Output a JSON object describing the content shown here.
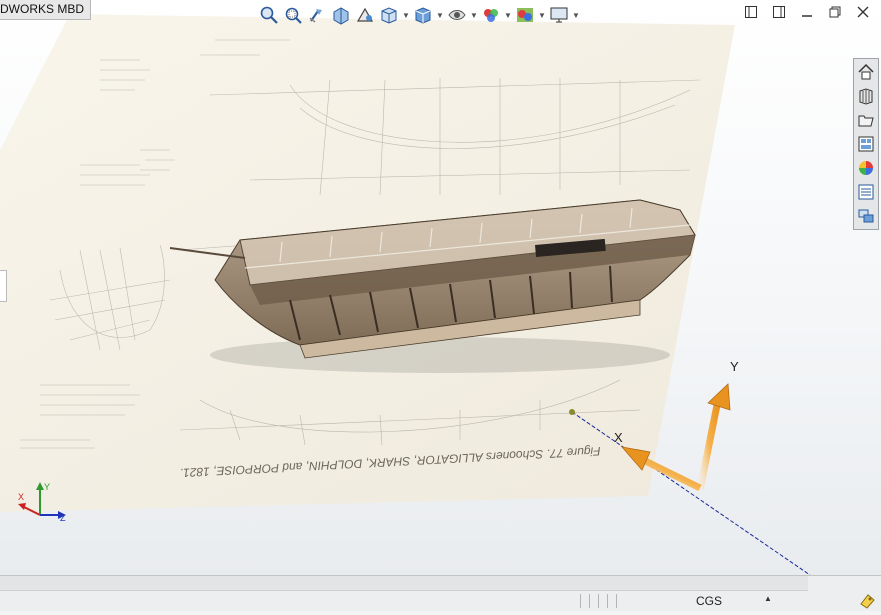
{
  "window": {
    "title": "DWORKS MBD"
  },
  "hud_tools": [
    {
      "name": "zoom-to-fit-icon"
    },
    {
      "name": "zoom-to-area-icon"
    },
    {
      "name": "previous-view-icon"
    },
    {
      "name": "section-view-icon"
    },
    {
      "name": "dynamic-annotation-icon"
    },
    {
      "name": "view-orientation-icon",
      "dropdown": true
    },
    {
      "name": "display-style-icon",
      "dropdown": true
    },
    {
      "name": "hide-show-items-icon",
      "dropdown": true
    },
    {
      "name": "edit-appearance-icon",
      "dropdown": true
    },
    {
      "name": "apply-scene-icon",
      "dropdown": true
    },
    {
      "name": "view-settings-icon",
      "dropdown": true
    }
  ],
  "task_pane": [
    {
      "name": "home-icon"
    },
    {
      "name": "design-library-icon"
    },
    {
      "name": "file-explorer-icon"
    },
    {
      "name": "view-palette-icon"
    },
    {
      "name": "appearances-icon"
    },
    {
      "name": "custom-properties-icon"
    },
    {
      "name": "forum-icon"
    }
  ],
  "drawing_text": {
    "caption": "Figure 77. Schooners ALLIGATOR, SHARK, DOLPHIN, and PORPOISE, 1821."
  },
  "axes": {
    "x_label": "X",
    "y_label": "Y"
  },
  "triad": {
    "x": "X",
    "y": "Y",
    "z": "Z"
  },
  "status": {
    "units": "CGS"
  },
  "colors": {
    "arrow": "#f0a030",
    "hull": "#a08c74",
    "paper": "#f6f2e6",
    "axis_line": "#1a2a9a"
  }
}
